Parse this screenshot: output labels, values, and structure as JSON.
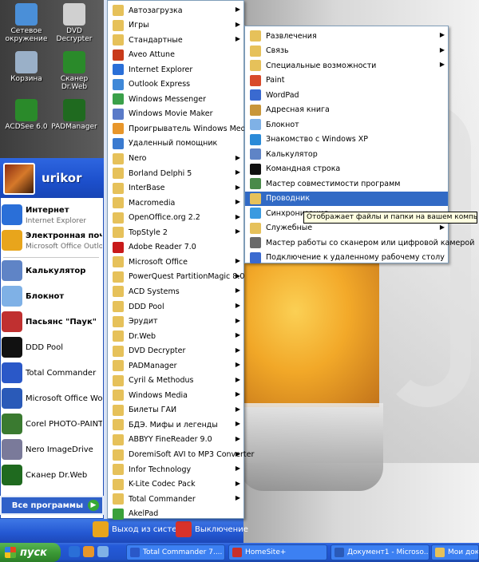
{
  "desktop": {
    "icons": [
      {
        "label": "Сетевое окружение",
        "icon": "network-icon",
        "color": "#4a8fd8"
      },
      {
        "label": "DVD Decrypter",
        "icon": "dvd-icon",
        "color": "#d0d0d0"
      },
      {
        "label": "Корзина",
        "icon": "recycle-bin-icon",
        "color": "#9ab0c8"
      },
      {
        "label": "Сканер Dr.Web",
        "icon": "drweb-spider-icon",
        "color": "#2a8a2a"
      },
      {
        "label": "ACDSee 6.0",
        "icon": "acdsee-icon",
        "color": "#2a8a2a"
      },
      {
        "label": "PADManager",
        "icon": "padmanager-icon",
        "color": "#1f6a1f"
      }
    ]
  },
  "start_menu": {
    "username": "urikor",
    "pinned": [
      {
        "title": "Интернет",
        "subtitle": "Internet Explorer",
        "icon": "internet-explorer-icon",
        "color": "#2a6fd8"
      },
      {
        "title": "Электронная почта",
        "subtitle": "Microsoft Office Outlook",
        "icon": "outlook-icon",
        "color": "#e8a51c"
      }
    ],
    "recent": [
      {
        "label": "Калькулятор",
        "icon": "calculator-icon",
        "color": "#5f84c6",
        "bold": true
      },
      {
        "label": "Блокнот",
        "icon": "notepad-icon",
        "color": "#7fb1e6",
        "bold": true
      },
      {
        "label": "Пасьянс \"Паук\"",
        "icon": "spider-solitaire-icon",
        "color": "#c03030",
        "bold": true
      },
      {
        "label": "DDD Pool",
        "icon": "pool-ball-icon",
        "color": "#111111",
        "bold": false
      },
      {
        "label": "Total Commander",
        "icon": "total-commander-icon",
        "color": "#2a58c8",
        "bold": false
      },
      {
        "label": "Microsoft Office Word 2003",
        "icon": "word-icon",
        "color": "#2a5ab8",
        "bold": false
      },
      {
        "label": "Corel PHOTO-PAINT 10",
        "icon": "corel-icon",
        "color": "#3a7a30",
        "bold": false
      },
      {
        "label": "Nero ImageDrive",
        "icon": "nero-icon",
        "color": "#7a7a9a",
        "bold": false
      },
      {
        "label": "Сканер Dr.Web",
        "icon": "drweb-spider-icon",
        "color": "#1f6a1f",
        "bold": false
      }
    ],
    "all_programs": "Все программы",
    "logoff": "Выход из системы",
    "shutdown": "Выключение"
  },
  "programs_menu": {
    "items": [
      {
        "label": "Автозагрузка",
        "icon": "folder-icon",
        "color": "#e6c15a",
        "submenu": true
      },
      {
        "label": "Игры",
        "icon": "folder-icon",
        "color": "#e6c15a",
        "submenu": true
      },
      {
        "label": "Стандартные",
        "icon": "folder-icon",
        "color": "#e6c15a",
        "submenu": true
      },
      {
        "label": "Aveo Attune",
        "icon": "aveo-icon",
        "color": "#c83a1a",
        "submenu": false
      },
      {
        "label": "Internet Explorer",
        "icon": "internet-explorer-icon",
        "color": "#2a6fd8",
        "submenu": false
      },
      {
        "label": "Outlook Express",
        "icon": "outlook-express-icon",
        "color": "#3f88d8",
        "submenu": false
      },
      {
        "label": "Windows Messenger",
        "icon": "messenger-icon",
        "color": "#3aa04a",
        "submenu": false
      },
      {
        "label": "Windows Movie Maker",
        "icon": "movie-maker-icon",
        "color": "#5a7ac8",
        "submenu": false
      },
      {
        "label": "Проигрыватель Windows Media",
        "icon": "media-player-icon",
        "color": "#e8962a",
        "submenu": false
      },
      {
        "label": "Удаленный помощник",
        "icon": "remote-assistance-icon",
        "color": "#3a7ad0",
        "submenu": false
      },
      {
        "label": "Nero",
        "icon": "folder-icon",
        "color": "#e6c15a",
        "submenu": true
      },
      {
        "label": "Borland Delphi 5",
        "icon": "folder-icon",
        "color": "#e6c15a",
        "submenu": true
      },
      {
        "label": "InterBase",
        "icon": "folder-icon",
        "color": "#e6c15a",
        "submenu": true
      },
      {
        "label": "Macromedia",
        "icon": "folder-icon",
        "color": "#e6c15a",
        "submenu": true
      },
      {
        "label": "OpenOffice.org 2.2",
        "icon": "folder-icon",
        "color": "#e6c15a",
        "submenu": true
      },
      {
        "label": "TopStyle 2",
        "icon": "folder-icon",
        "color": "#e6c15a",
        "submenu": true
      },
      {
        "label": "Adobe Reader 7.0",
        "icon": "adobe-reader-icon",
        "color": "#c81a1a",
        "submenu": false
      },
      {
        "label": "Microsoft Office",
        "icon": "folder-icon",
        "color": "#e6c15a",
        "submenu": true
      },
      {
        "label": "PowerQuest PartitionMagic 8.0",
        "icon": "folder-icon",
        "color": "#e6c15a",
        "submenu": true
      },
      {
        "label": "ACD Systems",
        "icon": "folder-icon",
        "color": "#e6c15a",
        "submenu": true
      },
      {
        "label": "DDD Pool",
        "icon": "folder-icon",
        "color": "#e6c15a",
        "submenu": true
      },
      {
        "label": "Эрудит",
        "icon": "folder-icon",
        "color": "#e6c15a",
        "submenu": true
      },
      {
        "label": "Dr.Web",
        "icon": "folder-icon",
        "color": "#e6c15a",
        "submenu": true
      },
      {
        "label": "DVD Decrypter",
        "icon": "folder-icon",
        "color": "#e6c15a",
        "submenu": true
      },
      {
        "label": "PADManager",
        "icon": "folder-icon",
        "color": "#e6c15a",
        "submenu": true
      },
      {
        "label": "Cyril & Methodus",
        "icon": "folder-icon",
        "color": "#e6c15a",
        "submenu": true
      },
      {
        "label": "Windows Media",
        "icon": "folder-icon",
        "color": "#e6c15a",
        "submenu": true
      },
      {
        "label": "Билеты ГАИ",
        "icon": "folder-icon",
        "color": "#e6c15a",
        "submenu": true
      },
      {
        "label": "БДЭ. Мифы и легенды",
        "icon": "folder-icon",
        "color": "#e6c15a",
        "submenu": true
      },
      {
        "label": "ABBYY FineReader 9.0",
        "icon": "folder-icon",
        "color": "#e6c15a",
        "submenu": true
      },
      {
        "label": "DoremiSoft AVI to MP3 Converter",
        "icon": "folder-icon",
        "color": "#e6c15a",
        "submenu": true
      },
      {
        "label": "Infor Technology",
        "icon": "folder-icon",
        "color": "#e6c15a",
        "submenu": true
      },
      {
        "label": "K-Lite Codec Pack",
        "icon": "folder-icon",
        "color": "#e6c15a",
        "submenu": true
      },
      {
        "label": "Total Commander",
        "icon": "folder-icon",
        "color": "#e6c15a",
        "submenu": true
      },
      {
        "label": "AkelPad",
        "icon": "akelpad-icon",
        "color": "#3aa03a",
        "submenu": false
      }
    ]
  },
  "accessories_menu": {
    "items": [
      {
        "label": "Развлечения",
        "icon": "folder-icon",
        "color": "#e6c15a",
        "submenu": true
      },
      {
        "label": "Связь",
        "icon": "folder-icon",
        "color": "#e6c15a",
        "submenu": true
      },
      {
        "label": "Специальные возможности",
        "icon": "folder-icon",
        "color": "#e6c15a",
        "submenu": true
      },
      {
        "label": "Paint",
        "icon": "paint-icon",
        "color": "#d84a2a",
        "submenu": false
      },
      {
        "label": "WordPad",
        "icon": "wordpad-icon",
        "color": "#3a6ad0",
        "submenu": false
      },
      {
        "label": "Адресная книга",
        "icon": "address-book-icon",
        "color": "#c8963a",
        "submenu": false
      },
      {
        "label": "Блокнот",
        "icon": "notepad-icon",
        "color": "#7fb1e6",
        "submenu": false
      },
      {
        "label": "Знакомство с Windows XP",
        "icon": "windows-tour-icon",
        "color": "#2a8ad8",
        "submenu": false
      },
      {
        "label": "Калькулятор",
        "icon": "calculator-icon",
        "color": "#5f84c6",
        "submenu": false
      },
      {
        "label": "Командная строка",
        "icon": "command-prompt-icon",
        "color": "#111111",
        "submenu": false
      },
      {
        "label": "Мастер совместимости программ",
        "icon": "compatibility-wizard-icon",
        "color": "#4a8a4a",
        "submenu": false
      },
      {
        "label": "Проводник",
        "icon": "explorer-icon",
        "color": "#e6c15a",
        "submenu": false,
        "highlighted": true
      },
      {
        "label": "Синхронизация",
        "icon": "sync-icon",
        "color": "#3a9ae0",
        "submenu": false
      },
      {
        "label": "Служебные",
        "icon": "folder-icon",
        "color": "#e6c15a",
        "submenu": true
      },
      {
        "label": "Мастер работы со сканером или цифровой камерой",
        "icon": "scanner-wizard-icon",
        "color": "#6a6a6a",
        "submenu": false
      },
      {
        "label": "Подключение к удаленному рабочему столу",
        "icon": "remote-desktop-icon",
        "color": "#3a6ad0",
        "submenu": false
      }
    ]
  },
  "tooltip": "Отображает файлы и папки на вашем компьютере.",
  "taskbar": {
    "start_label": "пуск",
    "quick_launch": [
      {
        "icon": "internet-explorer-icon",
        "color": "#2a6fd8"
      },
      {
        "icon": "media-player-icon",
        "color": "#e8962a"
      },
      {
        "icon": "show-desktop-icon",
        "color": "#7fb1e6"
      }
    ],
    "tasks": [
      {
        "label": "Total Commander 7....",
        "icon": "total-commander-icon",
        "color": "#2a58c8"
      },
      {
        "label": "HomeSite+",
        "icon": "homesite-icon",
        "color": "#c8302a"
      },
      {
        "label": "Документ1 - Microso...",
        "icon": "word-icon",
        "color": "#2a5ab8"
      },
      {
        "label": "Мои доку",
        "icon": "my-documents-icon",
        "color": "#e6c15a"
      }
    ]
  }
}
